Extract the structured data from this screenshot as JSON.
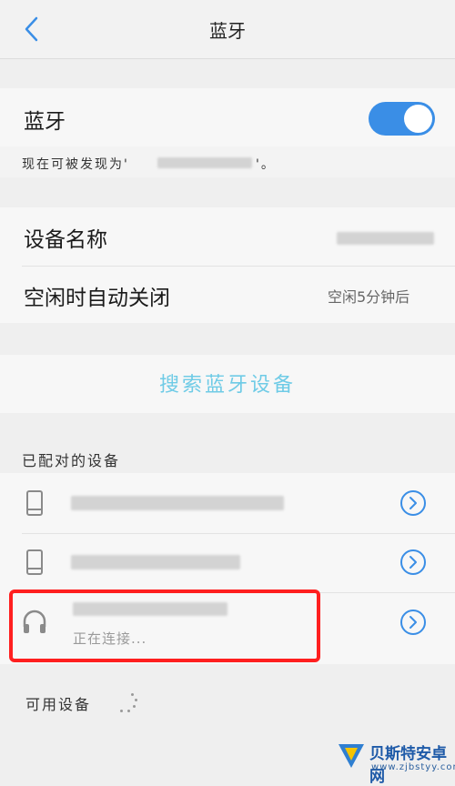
{
  "header": {
    "title": "蓝牙"
  },
  "bluetooth": {
    "label": "蓝牙",
    "enabled": true,
    "discoverable_prefix": "现在可被发现为'",
    "discoverable_suffix": "'。"
  },
  "settings": {
    "device_name_label": "设备名称",
    "auto_close_label": "空闲时自动关闭",
    "auto_close_value": "空闲5分钟后"
  },
  "search_button": "搜索蓝牙设备",
  "paired": {
    "header": "已配对的设备",
    "devices": [
      {
        "type": "phone-icon",
        "status": ""
      },
      {
        "type": "phone-icon",
        "status": ""
      },
      {
        "type": "headphones-icon",
        "status": "正在连接..."
      }
    ]
  },
  "available": {
    "header": "可用设备"
  },
  "watermark": {
    "name": "贝斯特安卓网",
    "url": "www.zjbstyy.com"
  },
  "colors": {
    "accent": "#3a8ee6",
    "search_text": "#6fcbe6",
    "highlight": "#ff1f1f"
  }
}
